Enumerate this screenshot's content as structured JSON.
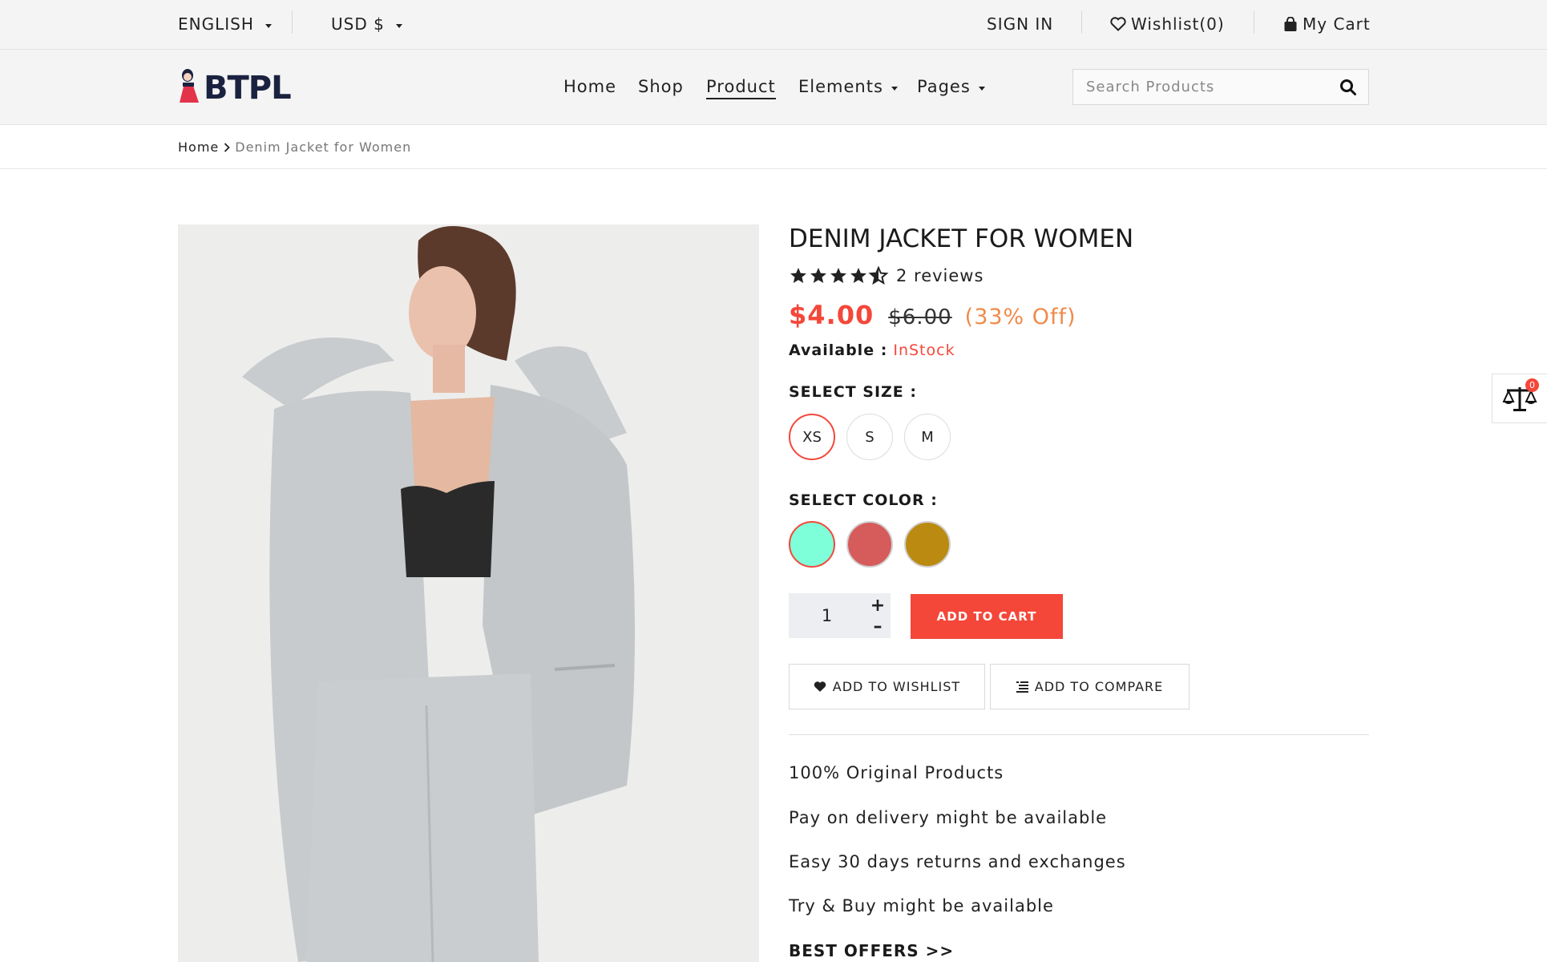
{
  "topbar": {
    "language": "ENGLISH",
    "currency": "USD $",
    "sign_in": "SIGN IN",
    "wishlist": "Wishlist(0)",
    "cart": "My Cart"
  },
  "header": {
    "logo_text": "BTPL",
    "nav": [
      {
        "label": "Home"
      },
      {
        "label": "Shop"
      },
      {
        "label": "Product",
        "active": true
      },
      {
        "label": "Elements",
        "dropdown": true
      },
      {
        "label": "Pages",
        "dropdown": true
      }
    ],
    "search": {
      "placeholder": "Search Products",
      "icon": "search-icon"
    }
  },
  "breadcrumb": {
    "home": "Home",
    "current": "Denim Jacket for Women"
  },
  "product": {
    "title": "DENIM JACKET FOR WOMEN",
    "rating_stars": 4.5,
    "reviews": "2 reviews",
    "price": "$4.00",
    "old_price": "$6.00",
    "discount": "(33% Off)",
    "availability_label": "Available :",
    "availability_value": "InStock",
    "size_label": "SELECT SIZE :",
    "sizes": [
      "XS",
      "S",
      "M"
    ],
    "selected_size": "XS",
    "color_label": "SELECT COLOR :",
    "colors": [
      "#7fffd9",
      "#d65b5b",
      "#bb8a10"
    ],
    "selected_color": "#7fffd9",
    "quantity": "1",
    "add_to_cart": "ADD TO CART",
    "add_to_wishlist": "ADD TO WISHLIST",
    "add_to_compare": "ADD TO COMPARE",
    "features": [
      "100% Original Products",
      "Pay on delivery might be available",
      "Easy 30 days returns and exchanges",
      "Try & Buy might be available"
    ],
    "best_offers": "BEST OFFERS >>"
  },
  "compare_widget": {
    "count": "0",
    "icon": "scale-icon"
  },
  "colors": {
    "accent": "#f4473a",
    "discount": "#f08a4b",
    "topbar_bg": "#f4f4f4"
  }
}
